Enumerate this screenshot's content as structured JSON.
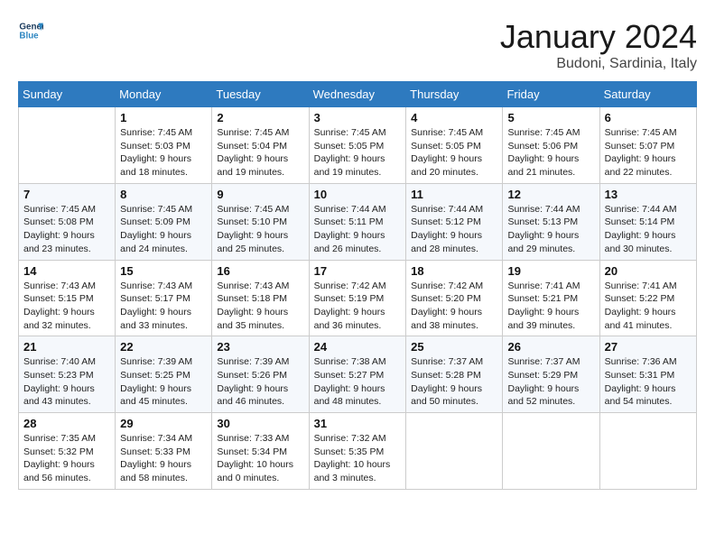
{
  "header": {
    "logo_line1": "General",
    "logo_line2": "Blue",
    "title": "January 2024",
    "subtitle": "Budoni, Sardinia, Italy"
  },
  "columns": [
    "Sunday",
    "Monday",
    "Tuesday",
    "Wednesday",
    "Thursday",
    "Friday",
    "Saturday"
  ],
  "weeks": [
    [
      {
        "day": "",
        "info": ""
      },
      {
        "day": "1",
        "info": "Sunrise: 7:45 AM\nSunset: 5:03 PM\nDaylight: 9 hours\nand 18 minutes."
      },
      {
        "day": "2",
        "info": "Sunrise: 7:45 AM\nSunset: 5:04 PM\nDaylight: 9 hours\nand 19 minutes."
      },
      {
        "day": "3",
        "info": "Sunrise: 7:45 AM\nSunset: 5:05 PM\nDaylight: 9 hours\nand 19 minutes."
      },
      {
        "day": "4",
        "info": "Sunrise: 7:45 AM\nSunset: 5:05 PM\nDaylight: 9 hours\nand 20 minutes."
      },
      {
        "day": "5",
        "info": "Sunrise: 7:45 AM\nSunset: 5:06 PM\nDaylight: 9 hours\nand 21 minutes."
      },
      {
        "day": "6",
        "info": "Sunrise: 7:45 AM\nSunset: 5:07 PM\nDaylight: 9 hours\nand 22 minutes."
      }
    ],
    [
      {
        "day": "7",
        "info": "Sunrise: 7:45 AM\nSunset: 5:08 PM\nDaylight: 9 hours\nand 23 minutes."
      },
      {
        "day": "8",
        "info": "Sunrise: 7:45 AM\nSunset: 5:09 PM\nDaylight: 9 hours\nand 24 minutes."
      },
      {
        "day": "9",
        "info": "Sunrise: 7:45 AM\nSunset: 5:10 PM\nDaylight: 9 hours\nand 25 minutes."
      },
      {
        "day": "10",
        "info": "Sunrise: 7:44 AM\nSunset: 5:11 PM\nDaylight: 9 hours\nand 26 minutes."
      },
      {
        "day": "11",
        "info": "Sunrise: 7:44 AM\nSunset: 5:12 PM\nDaylight: 9 hours\nand 28 minutes."
      },
      {
        "day": "12",
        "info": "Sunrise: 7:44 AM\nSunset: 5:13 PM\nDaylight: 9 hours\nand 29 minutes."
      },
      {
        "day": "13",
        "info": "Sunrise: 7:44 AM\nSunset: 5:14 PM\nDaylight: 9 hours\nand 30 minutes."
      }
    ],
    [
      {
        "day": "14",
        "info": "Sunrise: 7:43 AM\nSunset: 5:15 PM\nDaylight: 9 hours\nand 32 minutes."
      },
      {
        "day": "15",
        "info": "Sunrise: 7:43 AM\nSunset: 5:17 PM\nDaylight: 9 hours\nand 33 minutes."
      },
      {
        "day": "16",
        "info": "Sunrise: 7:43 AM\nSunset: 5:18 PM\nDaylight: 9 hours\nand 35 minutes."
      },
      {
        "day": "17",
        "info": "Sunrise: 7:42 AM\nSunset: 5:19 PM\nDaylight: 9 hours\nand 36 minutes."
      },
      {
        "day": "18",
        "info": "Sunrise: 7:42 AM\nSunset: 5:20 PM\nDaylight: 9 hours\nand 38 minutes."
      },
      {
        "day": "19",
        "info": "Sunrise: 7:41 AM\nSunset: 5:21 PM\nDaylight: 9 hours\nand 39 minutes."
      },
      {
        "day": "20",
        "info": "Sunrise: 7:41 AM\nSunset: 5:22 PM\nDaylight: 9 hours\nand 41 minutes."
      }
    ],
    [
      {
        "day": "21",
        "info": "Sunrise: 7:40 AM\nSunset: 5:23 PM\nDaylight: 9 hours\nand 43 minutes."
      },
      {
        "day": "22",
        "info": "Sunrise: 7:39 AM\nSunset: 5:25 PM\nDaylight: 9 hours\nand 45 minutes."
      },
      {
        "day": "23",
        "info": "Sunrise: 7:39 AM\nSunset: 5:26 PM\nDaylight: 9 hours\nand 46 minutes."
      },
      {
        "day": "24",
        "info": "Sunrise: 7:38 AM\nSunset: 5:27 PM\nDaylight: 9 hours\nand 48 minutes."
      },
      {
        "day": "25",
        "info": "Sunrise: 7:37 AM\nSunset: 5:28 PM\nDaylight: 9 hours\nand 50 minutes."
      },
      {
        "day": "26",
        "info": "Sunrise: 7:37 AM\nSunset: 5:29 PM\nDaylight: 9 hours\nand 52 minutes."
      },
      {
        "day": "27",
        "info": "Sunrise: 7:36 AM\nSunset: 5:31 PM\nDaylight: 9 hours\nand 54 minutes."
      }
    ],
    [
      {
        "day": "28",
        "info": "Sunrise: 7:35 AM\nSunset: 5:32 PM\nDaylight: 9 hours\nand 56 minutes."
      },
      {
        "day": "29",
        "info": "Sunrise: 7:34 AM\nSunset: 5:33 PM\nDaylight: 9 hours\nand 58 minutes."
      },
      {
        "day": "30",
        "info": "Sunrise: 7:33 AM\nSunset: 5:34 PM\nDaylight: 10 hours\nand 0 minutes."
      },
      {
        "day": "31",
        "info": "Sunrise: 7:32 AM\nSunset: 5:35 PM\nDaylight: 10 hours\nand 3 minutes."
      },
      {
        "day": "",
        "info": ""
      },
      {
        "day": "",
        "info": ""
      },
      {
        "day": "",
        "info": ""
      }
    ]
  ]
}
